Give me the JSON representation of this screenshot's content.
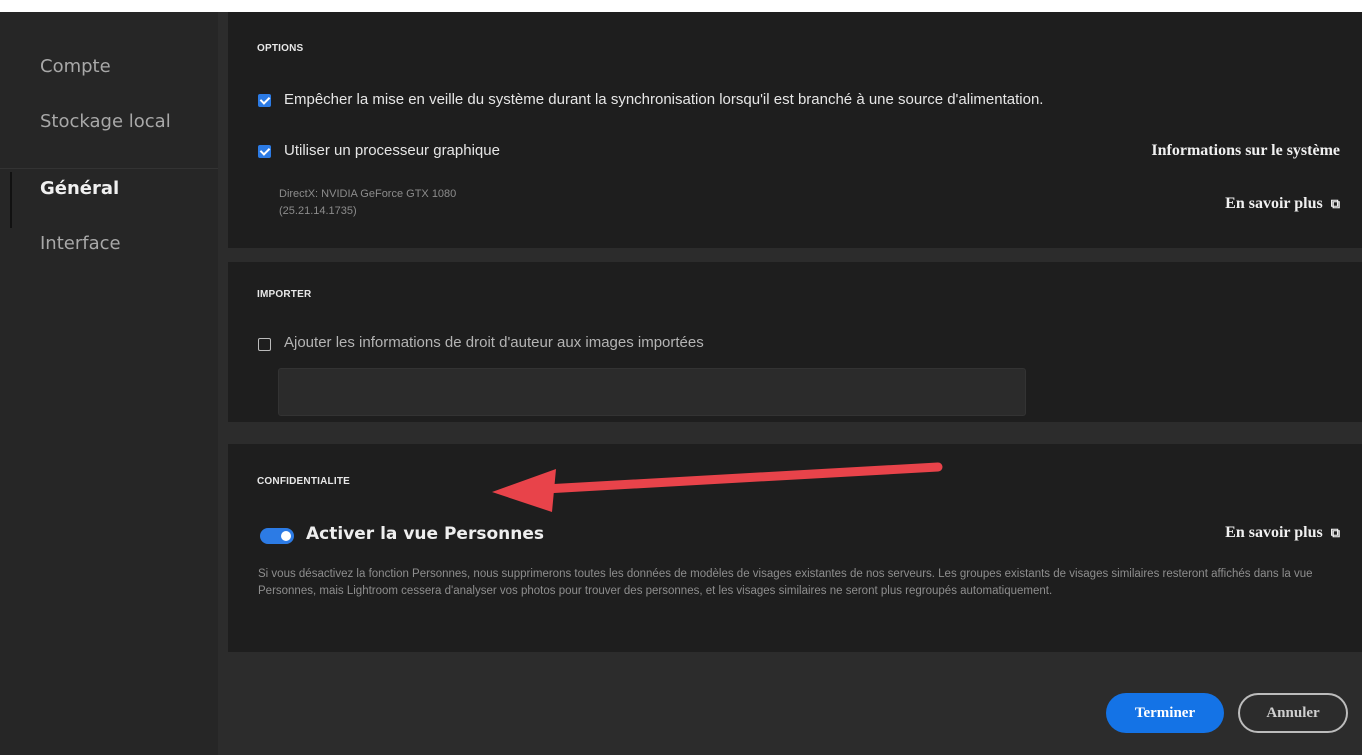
{
  "sidebar": {
    "items": [
      {
        "label": "Compte",
        "active": false
      },
      {
        "label": "Stockage local",
        "active": false
      },
      {
        "label": "Général",
        "active": true
      },
      {
        "label": "Interface",
        "active": false
      }
    ]
  },
  "options": {
    "title": "OPTIONS",
    "prevent_sleep": {
      "label": "Empêcher la mise en veille du système durant la synchronisation lorsqu'il est branché à une source d'alimentation.",
      "checked": true
    },
    "use_gpu": {
      "label": "Utiliser un processeur graphique",
      "checked": true
    },
    "gpu_info_line1": "DirectX: NVIDIA GeForce GTX 1080",
    "gpu_info_line2": "(25.21.14.1735)",
    "system_info_link": "Informations sur le système",
    "learn_more_link": "En savoir plus"
  },
  "importer": {
    "title": "IMPORTER",
    "copyright": {
      "label": "Ajouter les informations de droit d'auteur aux images importées",
      "checked": false
    },
    "copyright_value": ""
  },
  "confidentialite": {
    "title": "CONFIDENTIALITE",
    "people_toggle": {
      "label": "Activer la vue Personnes",
      "on": true
    },
    "learn_more_link": "En savoir plus",
    "description": "Si vous désactivez la fonction Personnes, nous supprimerons toutes les données de modèles de visages existantes de nos serveurs. Les groupes existants de visages similaires resteront affichés dans la vue Personnes, mais Lightroom cessera d'analyser vos photos pour trouver des personnes, et les visages similaires ne seront plus regroupés automatiquement."
  },
  "footer": {
    "done_label": "Terminer",
    "cancel_label": "Annuler"
  },
  "colors": {
    "accent": "#1473e6",
    "annotation_arrow": "#e8434a"
  }
}
